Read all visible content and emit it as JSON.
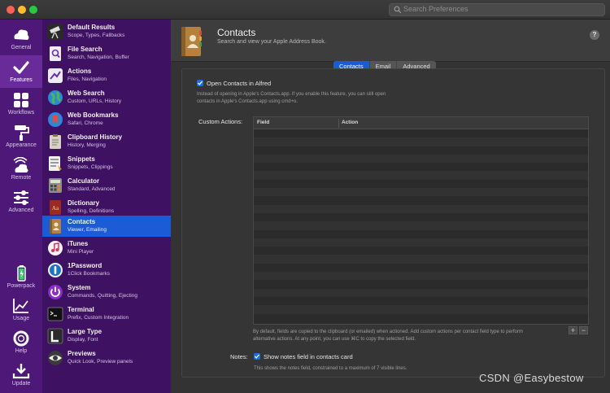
{
  "search": {
    "placeholder": "Search Preferences"
  },
  "nav": [
    {
      "label": "General",
      "icon": "general-icon"
    },
    {
      "label": "Features",
      "icon": "checkmark-icon",
      "active": true
    },
    {
      "label": "Workflows",
      "icon": "grid-icon"
    },
    {
      "label": "Appearance",
      "icon": "paint-roller-icon"
    },
    {
      "label": "Remote",
      "icon": "remote-icon"
    },
    {
      "label": "Advanced",
      "icon": "sliders-icon"
    },
    {
      "label": "Powerpack",
      "icon": "battery-icon"
    },
    {
      "label": "Usage",
      "icon": "chart-icon"
    },
    {
      "label": "Help",
      "icon": "lifebuoy-icon"
    },
    {
      "label": "Update",
      "icon": "download-icon"
    }
  ],
  "features": [
    {
      "title": "Default Results",
      "sub": "Scope, Types, Fallbacks",
      "icon": "telescope-icon",
      "color": "#2a2a2a"
    },
    {
      "title": "File Search",
      "sub": "Search, Navigation, Buffer",
      "icon": "file-search-icon",
      "color": "#e8e8f0"
    },
    {
      "title": "Actions",
      "sub": "Files, Navigation",
      "icon": "actions-icon",
      "color": "#e6e6ee"
    },
    {
      "title": "Web Search",
      "sub": "Custom, URLs, History",
      "icon": "globe-icon",
      "color": "#2f8f6a"
    },
    {
      "title": "Web Bookmarks",
      "sub": "Safari, Chrome",
      "icon": "bookmark-icon",
      "color": "#2e7fd2"
    },
    {
      "title": "Clipboard History",
      "sub": "History, Merging",
      "icon": "clipboard-icon",
      "color": "#d9d2c4"
    },
    {
      "title": "Snippets",
      "sub": "Snippets, Clippings",
      "icon": "snippets-icon",
      "color": "#e4e4e4"
    },
    {
      "title": "Calculator",
      "sub": "Standard, Advanced",
      "icon": "calculator-icon",
      "color": "#8d8d8d"
    },
    {
      "title": "Dictionary",
      "sub": "Spelling, Definitions",
      "icon": "dictionary-icon",
      "color": "#9b2b22"
    },
    {
      "title": "Contacts",
      "sub": "Viewer, Emailing",
      "icon": "contacts-book-icon",
      "color": "#b4823e",
      "active": true
    },
    {
      "title": "iTunes",
      "sub": "Mini Player",
      "icon": "music-note-icon",
      "color": "#f4f4f4"
    },
    {
      "title": "1Password",
      "sub": "1Click Bookmarks",
      "icon": "onepassword-icon",
      "color": "#f1f1f1"
    },
    {
      "title": "System",
      "sub": "Commands, Quitting, Ejecting",
      "icon": "power-icon",
      "color": "#8a2fc6"
    },
    {
      "title": "Terminal",
      "sub": "Prefix, Custom Integration",
      "icon": "terminal-icon",
      "color": "#111111"
    },
    {
      "title": "Large Type",
      "sub": "Display, Font",
      "icon": "large-type-icon",
      "color": "#2b2b2b"
    },
    {
      "title": "Previews",
      "sub": "Quick Look, Preview panels",
      "icon": "eye-icon",
      "color": "#3a3a3a"
    }
  ],
  "header": {
    "title": "Contacts",
    "subtitle": "Search and view your Apple Address Book.",
    "help": "?"
  },
  "tabs": [
    {
      "label": "Contacts",
      "selected": true
    },
    {
      "label": "Email"
    },
    {
      "label": "Advanced"
    }
  ],
  "settings": {
    "open_in_alfred_label": "Open Contacts in Alfred",
    "open_in_alfred_checked": true,
    "open_in_alfred_desc": "Instead of opening in Apple's Contacts.app. If you enable this feature, you can still open contacts in Apple's Contacts.app using cmd+o.",
    "custom_actions_label": "Custom Actions:",
    "table_headers": [
      "Field",
      "Action"
    ],
    "table_desc": "By default, fields are copied to the clipboard (or emailed) when actioned. Add custom actions per contact field type to perform alternative actions. At any point, you can use ⌘C to copy the selected field.",
    "add_label": "+",
    "remove_label": "−",
    "notes_label": "Notes:",
    "notes_checkbox_label": "Show notes field in contacts card",
    "notes_checked": true,
    "notes_desc": "This shows the notes field, constrained to a maximum of 7 visible lines."
  },
  "watermark": "CSDN @Easybestow",
  "colors": {
    "accent": "#1b5bd6",
    "sidebar": "#4d1877",
    "list": "#3e1162"
  }
}
